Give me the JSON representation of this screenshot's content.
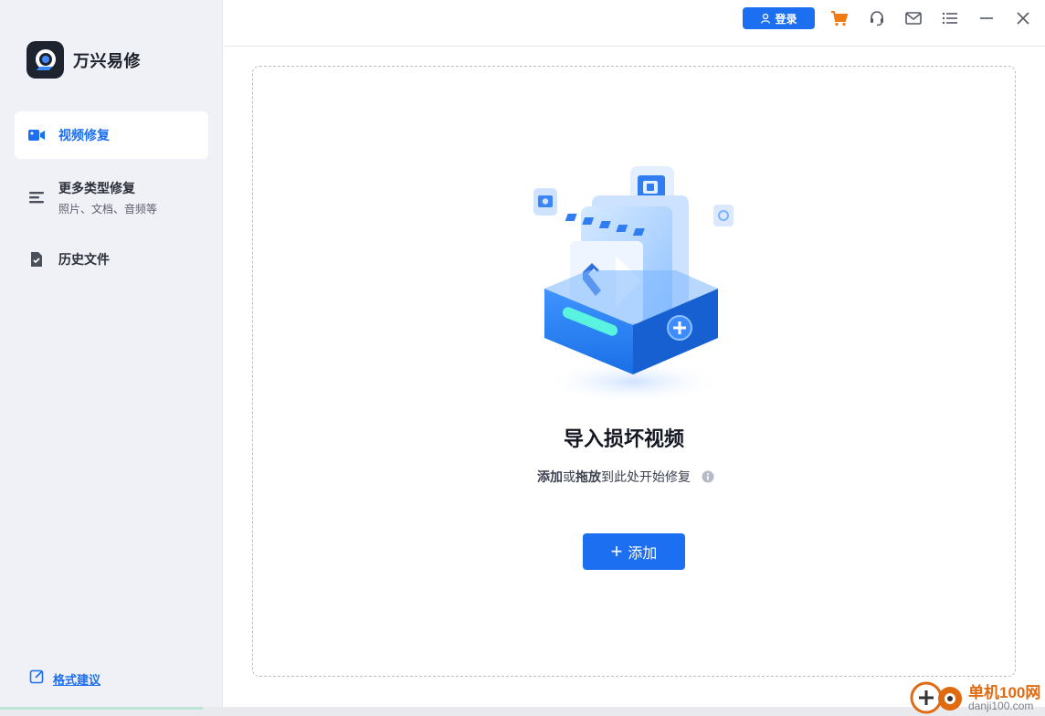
{
  "app": {
    "name": "万兴易修"
  },
  "sidebar": {
    "items": [
      {
        "label": "视频修复",
        "icon": "video-camera-icon",
        "active": true
      },
      {
        "label": "更多类型修复",
        "sublabel": "照片、文档、音频等",
        "icon": "list-icon",
        "active": false
      },
      {
        "label": "历史文件",
        "icon": "file-check-icon",
        "active": false
      }
    ],
    "feedback_label": "格式建议"
  },
  "topbar": {
    "login_label": "登录",
    "icons": [
      "cart-icon",
      "headset-icon",
      "mail-icon",
      "menu-icon",
      "minimize-icon",
      "close-icon"
    ]
  },
  "dropzone": {
    "title": "导入损坏视频",
    "hint_add": "添加",
    "hint_or": "或",
    "hint_drag": "拖放",
    "hint_rest": "到此处开始修复",
    "add_button_label": "添加"
  },
  "watermark": {
    "line1": "单机100网",
    "line2": "danji100.com"
  },
  "colors": {
    "accent": "#1d6ff2",
    "sidebar_bg": "#f0f1f7",
    "cart": "#f07a14"
  }
}
